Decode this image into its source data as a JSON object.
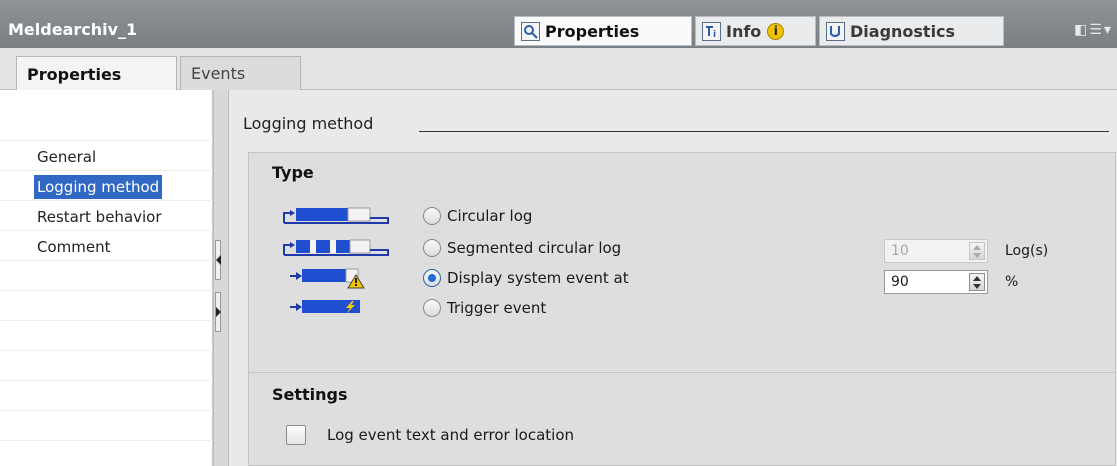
{
  "window": {
    "title": "Meldearchiv_1",
    "tabs": [
      {
        "label": "Properties",
        "icon": "properties-icon"
      },
      {
        "label": "Info",
        "icon": "info-icon"
      },
      {
        "label": "Diagnostics",
        "icon": "diagnostics-icon"
      }
    ],
    "info_badge": "i"
  },
  "subtabs": [
    {
      "label": "Properties",
      "active": true
    },
    {
      "label": "Events",
      "active": false
    }
  ],
  "nav": {
    "items": [
      {
        "label": "General",
        "selected": false
      },
      {
        "label": "Logging method",
        "selected": true
      },
      {
        "label": "Restart behavior",
        "selected": false
      },
      {
        "label": "Comment",
        "selected": false
      }
    ]
  },
  "main": {
    "section_title": "Logging method",
    "type_group": {
      "title": "Type",
      "options": [
        {
          "label": "Circular log",
          "checked": false,
          "icon": "circular-log-icon"
        },
        {
          "label": "Segmented circular log",
          "checked": false,
          "icon": "segmented-log-icon"
        },
        {
          "label": "Display system event at",
          "checked": true,
          "icon": "system-event-icon"
        },
        {
          "label": "Trigger event",
          "checked": false,
          "icon": "trigger-event-icon"
        }
      ],
      "log_count": {
        "value": "10",
        "unit": "Log(s)",
        "enabled": false
      },
      "percent": {
        "value": "90",
        "unit": "%",
        "enabled": true
      }
    },
    "settings_group": {
      "title": "Settings",
      "checkbox_label": "Log event text and error location",
      "checked": false
    }
  },
  "colors": {
    "titlebar": "#8a8f93",
    "selection": "#3168c4",
    "bar_blue": "#1f4fd0",
    "warning": "#f2c400"
  }
}
